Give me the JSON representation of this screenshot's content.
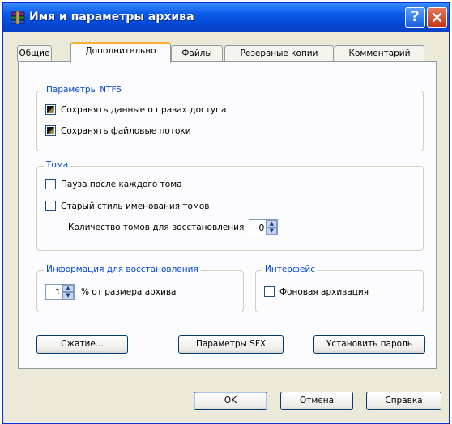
{
  "window": {
    "title": "Имя и параметры архива",
    "help_label": "?",
    "close_label": "✕"
  },
  "tabs": [
    {
      "label": "Общие"
    },
    {
      "label": "Дополнительно",
      "active": true
    },
    {
      "label": "Файлы"
    },
    {
      "label": "Резервные копии"
    },
    {
      "label": "Комментарий"
    }
  ],
  "ntfs": {
    "title": "Параметры NTFS",
    "save_access_rights": {
      "label": "Сохранять данные о правах доступа",
      "checked": true
    },
    "save_file_streams": {
      "label": "Сохранять файловые потоки",
      "checked": true
    }
  },
  "volumes": {
    "title": "Тома",
    "pause_after_volume": {
      "label": "Пауза после каждого тома",
      "checked": false
    },
    "old_naming": {
      "label": "Старый стиль именования томов",
      "checked": false
    },
    "recovery_volumes_label": "Количество томов для восстановления",
    "recovery_volumes_value": "0"
  },
  "recovery_record": {
    "title": "Информация для восстановления",
    "value": "1",
    "suffix": "% от размера архива"
  },
  "interface": {
    "title": "Интерфейс",
    "background_archiving": {
      "label": "Фоновая архивация",
      "checked": false
    }
  },
  "panel_buttons": {
    "compression": "Сжатие...",
    "sfx_options": "Параметры SFX",
    "set_password": "Установить пароль"
  },
  "dialog_buttons": {
    "ok": "OK",
    "cancel": "Отмена",
    "help": "Справка"
  },
  "colors": {
    "title_bar": "#0A5BE8",
    "group_title": "#0046D5",
    "active_tab_accent": "#F9B02D",
    "face": "#ECE9D8"
  }
}
